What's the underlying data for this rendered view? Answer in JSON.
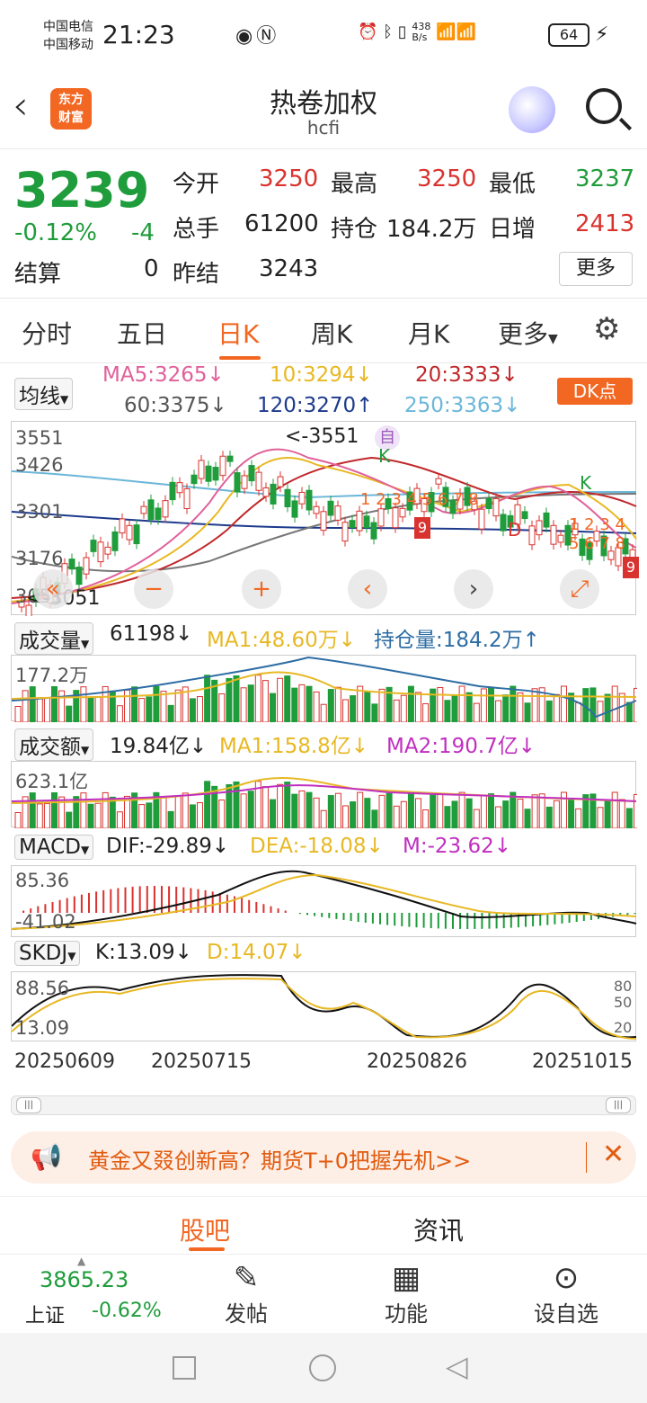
{
  "status": {
    "carrier1": "中国电信",
    "carrier2": "中国移动",
    "time": "21:23",
    "speed_top": "438",
    "speed_bottom": "B/s",
    "battery": "64"
  },
  "header": {
    "logo_line1": "东方",
    "logo_line2": "财富",
    "title": "热卷加权",
    "subtitle": "hcfi"
  },
  "quote": {
    "price": "3239",
    "change_pct": "-0.12%",
    "change": "-4",
    "settle_label": "结算",
    "settle": "0",
    "open_label": "今开",
    "open": "3250",
    "high_label": "最高",
    "high": "3250",
    "low_label": "最低",
    "low": "3237",
    "volume_label": "总手",
    "volume": "61200",
    "oi_label": "持仓",
    "oi": "184.2万",
    "daily_inc_label": "日增",
    "daily_inc": "2413",
    "prev_settle_label": "昨结",
    "prev_settle": "3243",
    "more": "更多"
  },
  "tabs": [
    "分时",
    "五日",
    "日K",
    "周K",
    "月K",
    "更多"
  ],
  "ma": {
    "selector": "均线",
    "ma5": "MA5:3265↓",
    "ma10": "10:3294↓",
    "ma20": "20:3333↓",
    "ma60": "60:3375↓",
    "ma120": "120:3270↑",
    "ma250": "250:3363↓",
    "dk": "DK点"
  },
  "kline": {
    "axis": [
      "3551",
      "3426",
      "3301",
      "3176",
      "3051"
    ],
    "max_label": "<-3551",
    "min_label": "<-3051",
    "self_tag": "自",
    "k_tag": "K",
    "d_tag": "D",
    "nine1": "9",
    "nine2": "9"
  },
  "volume": {
    "selector": "成交量",
    "value": "61198↓",
    "ma1": "MA1:48.60万↓",
    "oi": "持仓量:184.2万↑",
    "axis": "177.2万"
  },
  "amount": {
    "selector": "成交额",
    "value": "19.84亿↓",
    "ma1": "MA1:158.8亿↓",
    "ma2": "MA2:190.7亿↓",
    "axis": "623.1亿"
  },
  "macd": {
    "selector": "MACD",
    "dif": "DIF:-29.89↓",
    "dea": "DEA:-18.08↓",
    "m": "M:-23.62↓",
    "axis_top": "85.36",
    "axis_bottom": "-41.02"
  },
  "skdj": {
    "selector": "SKDJ",
    "k": "K:13.09↓",
    "d": "D:14.07↓",
    "axis_top": "88.56",
    "axis_bottom": "13.09",
    "r80": "80",
    "r50": "50",
    "r20": "20"
  },
  "dates": [
    "20250609",
    "20250715",
    "20250826",
    "20251015"
  ],
  "banner": {
    "text": "黄金又叕创新高？期货T+0把握先机>>"
  },
  "bottom_tabs": [
    "股吧",
    "资讯"
  ],
  "bottom_nav": {
    "index_value": "3865.23",
    "index_name": "上证",
    "index_change": "-0.62%",
    "post": "发帖",
    "func": "功能",
    "watch": "设自选"
  },
  "colors": {
    "up": "#d9332f",
    "down": "#1f9c3b",
    "accent": "#f26722"
  }
}
